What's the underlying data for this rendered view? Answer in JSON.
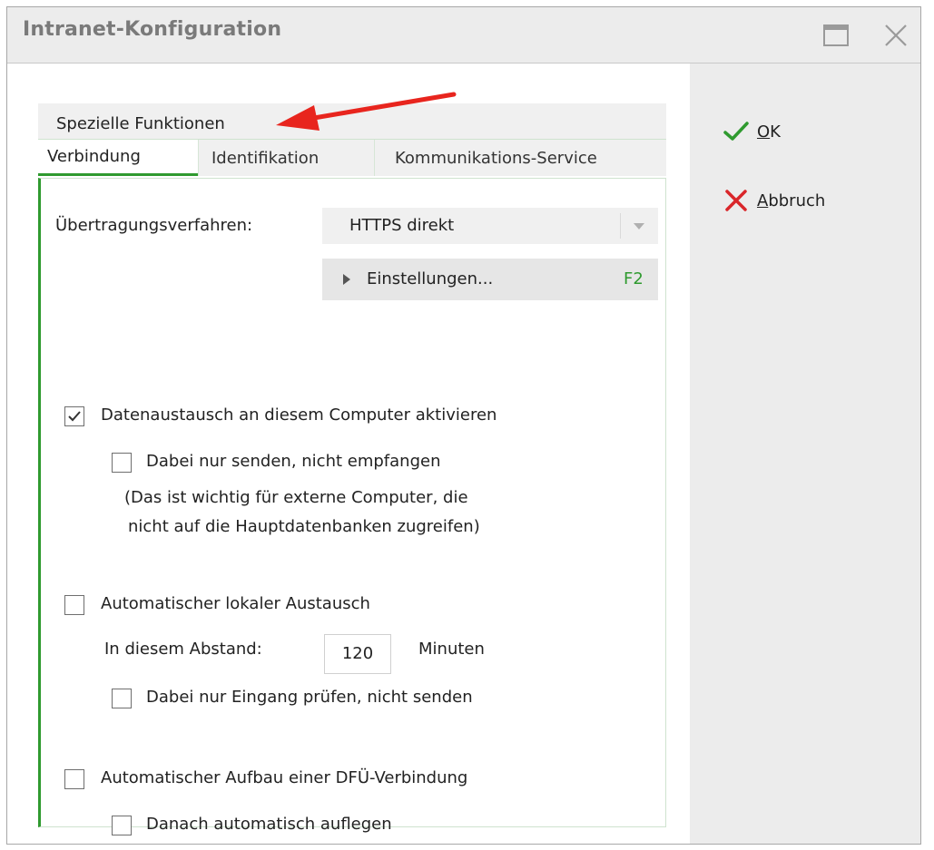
{
  "window": {
    "title": "Intranet-Konfiguration"
  },
  "sidebar": {
    "ok_label": "K",
    "ok_mnemonic": "O",
    "cancel_label": "bbruch",
    "cancel_mnemonic": "A"
  },
  "tabs": {
    "top": "Spezielle Funktionen",
    "items": [
      {
        "label": "Verbindung"
      },
      {
        "label": "Identifikation"
      },
      {
        "label": "Kommunikations-Service"
      }
    ]
  },
  "connection": {
    "method_label": "Übertragungsverfahren:",
    "method_value": "HTTPS direkt",
    "settings_label": "Einstellungen...",
    "settings_key": "F2"
  },
  "options": {
    "enable_exchange": {
      "label": "Datenaustausch an diesem Computer aktivieren",
      "checked": true
    },
    "send_only": {
      "label": "Dabei nur senden, nicht empfangen",
      "checked": false
    },
    "note_line1": "(Das ist wichtig für externe Computer, die",
    "note_line2": "nicht auf die Hauptdatenbanken zugreifen)",
    "auto_local": {
      "label": "Automatischer lokaler Austausch",
      "checked": false
    },
    "interval_label": "In diesem Abstand:",
    "interval_value": "120",
    "interval_unit": "Minuten",
    "check_only": {
      "label": "Dabei nur Eingang prüfen, nicht senden",
      "checked": false
    },
    "auto_dialup": {
      "label": "Automatischer Aufbau einer DFÜ-Verbindung",
      "checked": false
    },
    "hangup": {
      "label": "Danach automatisch auflegen",
      "checked": false
    }
  },
  "colors": {
    "accent_green": "#2f9a2f",
    "cancel_red": "#d9262a",
    "arrow_red": "#e8251e"
  }
}
